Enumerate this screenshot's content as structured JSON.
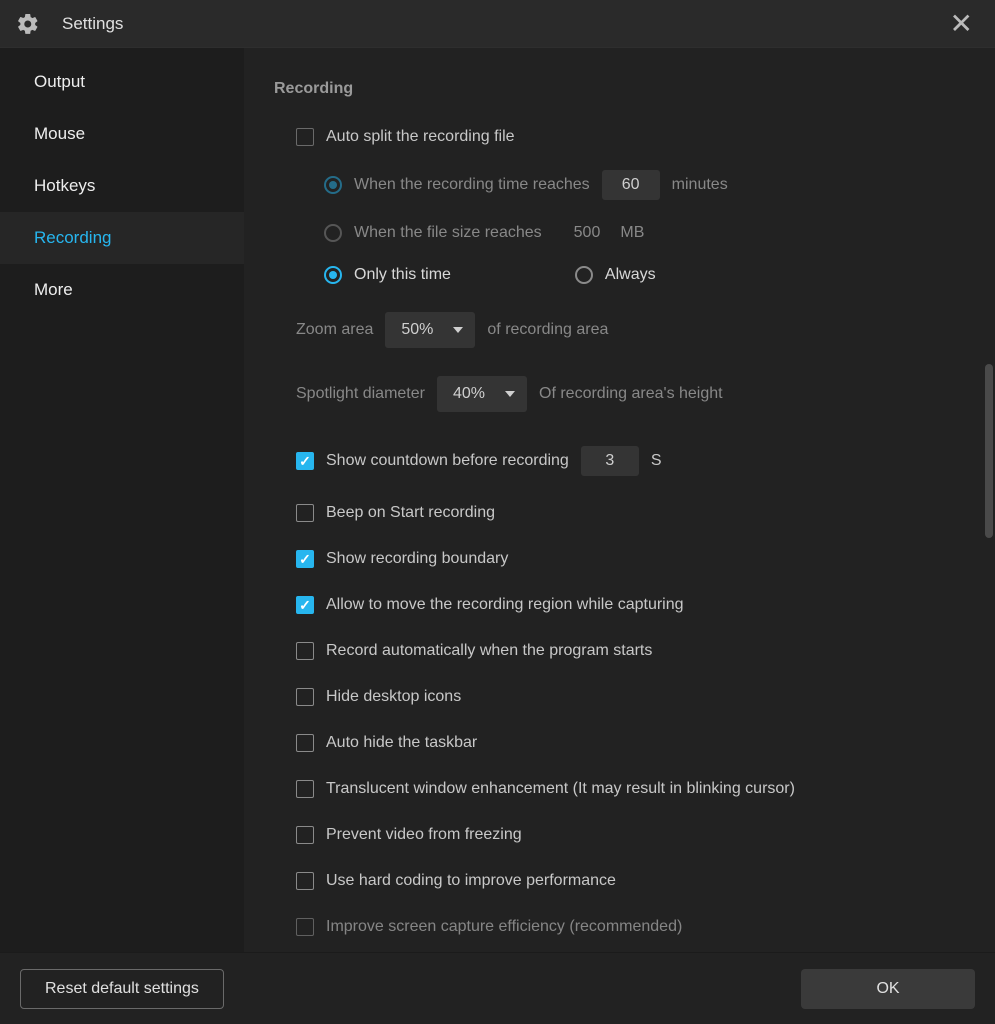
{
  "header": {
    "title": "Settings"
  },
  "sidebar": {
    "items": [
      {
        "label": "Output"
      },
      {
        "label": "Mouse"
      },
      {
        "label": "Hotkeys"
      },
      {
        "label": "Recording",
        "active": true
      },
      {
        "label": "More"
      }
    ]
  },
  "panel": {
    "section_title": "Recording",
    "auto_split": {
      "label": "Auto split the recording file",
      "time_reach_label": "When the recording time reaches",
      "time_value": "60",
      "time_unit": "minutes",
      "size_reach_label": "When the file size reaches",
      "size_value": "500",
      "size_unit": "MB",
      "only_this_time": "Only this time",
      "always": "Always"
    },
    "zoom": {
      "label": "Zoom area",
      "value": "50%",
      "suffix": "of recording area"
    },
    "spotlight": {
      "label": "Spotlight diameter",
      "value": "40%",
      "suffix": "Of recording area's height"
    },
    "countdown": {
      "label": "Show countdown before recording",
      "value": "3",
      "unit": "S"
    },
    "beep_label": "Beep on Start recording",
    "boundary_label": "Show recording boundary",
    "move_region_label": "Allow to move the recording region while capturing",
    "auto_record_label": "Record automatically when the program starts",
    "hide_icons_label": "Hide desktop icons",
    "hide_taskbar_label": "Auto hide the taskbar",
    "translucent_label": "Translucent window enhancement (It may result in blinking cursor)",
    "prevent_freeze_label": "Prevent video from freezing",
    "hard_coding_label": "Use hard coding to improve performance",
    "improve_capture_label": "Improve screen capture efficiency (recommended)"
  },
  "footer": {
    "reset_label": "Reset default settings",
    "ok_label": "OK"
  }
}
